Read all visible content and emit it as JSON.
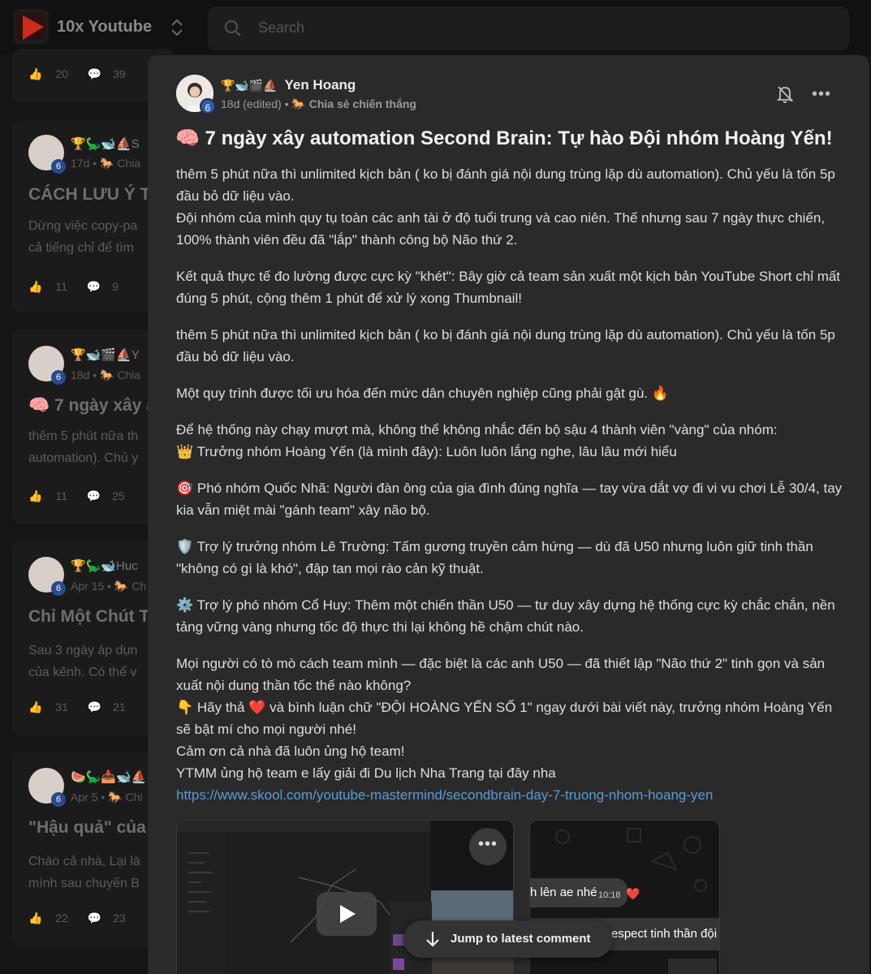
{
  "app": {
    "name": "10x Youtube",
    "search_placeholder": "Search"
  },
  "feed": {
    "top_stats": {
      "likes": "20",
      "comments": "39"
    },
    "cards": [
      {
        "badges": "🏆🦕🐋⛵",
        "author": "S",
        "meta": "17d • 🐎 Chia",
        "title": "CÁCH LƯU Ý T",
        "body1": "Dừng việc copy-pa",
        "body2": "cả tiếng chỉ để tìm",
        "likes": "11",
        "comments": "9"
      },
      {
        "badges": "🏆🐋🎬⛵",
        "author": "Y",
        "meta": "18d • 🐎 Chia",
        "title": "🧠 7 ngày xây a",
        "body1": "thêm 5 phút nữa th",
        "body2": "automation). Chủ y",
        "likes": "11",
        "comments": "25"
      },
      {
        "badges": "🏆🦕🐋",
        "author": "Huc",
        "meta": "Apr 15 • 🐎 Ch",
        "title": "Chỉ Một Chút T",
        "body1": "Sau 3 ngày áp dụn",
        "body2": "của kênh. Có thể v",
        "likes": "31",
        "comments": "21"
      },
      {
        "badges": "🍉🦕📥🐋⛵",
        "author": "",
        "meta": "Apr 5 • 🐎 Chi",
        "title": "\"Hậu quả\" của",
        "body1": "Chào cả nhà, Lại là",
        "body2": "mình sau chuyến B",
        "likes": "22",
        "comments": "23"
      }
    ]
  },
  "post": {
    "author": {
      "badges": "🏆🐋🎬⛵",
      "name": "Yen Hoang",
      "level": "6",
      "time": "18d (edited)",
      "category": "🐎 Chia sẻ chiến thắng"
    },
    "title": "🧠 7 ngày xây automation Second Brain: Tự hào Đội nhóm Hoàng Yến!",
    "paragraphs": [
      [
        "thêm 5 phút nữa thì unlimited kịch bản ( ko bị đánh giá nội dung trùng lặp dù automation). Chủ yếu là tốn 5p đầu bỏ dữ liệu vào.",
        "Đội nhóm của mình quy tụ toàn các anh tài ở độ tuổi trung và cao niên. Thế nhưng sau 7 ngày thực chiến, 100% thành viên đều đã \"lắp\" thành công bộ Não thứ 2."
      ],
      [
        "Kết quả thực tế đo lường được cực kỳ \"khét\": Bây giờ cả team sản xuất một kịch bản YouTube Short chỉ mất đúng 5 phút, cộng thêm 1 phút để xử lý xong Thumbnail!"
      ],
      [
        "thêm 5 phút nữa thì unlimited kịch bản ( ko bị đánh giá nội dung trùng lặp dù automation). Chủ yếu là tốn 5p đầu bỏ dữ liệu vào."
      ],
      [
        "Một quy trình được tối ưu hóa đến mức dân chuyên nghiệp cũng phải gật gù. 🔥"
      ],
      [
        "Để hệ thống này chạy mượt mà, không thể không nhắc đến bộ sậu 4 thành viên \"vàng\" của nhóm:",
        "👑 Trưởng nhóm Hoàng Yến (là mình đây): Luôn luôn lắng nghe, lâu lâu mới hiểu"
      ],
      [
        "🎯 Phó nhóm Quốc Nhã: Người đàn ông của gia đình đúng nghĩa — tay vừa dắt vợ đi vi vu chơi Lễ 30/4, tay kia vẫn miệt mài \"gánh team\" xây não bộ."
      ],
      [
        "🛡️ Trợ lý trưởng nhóm Lê Trường: Tấm gương truyền cảm hứng — dù đã U50 nhưng luôn giữ tinh thần \"không có gì là khó\", đập tan mọi rào cản kỹ thuật."
      ],
      [
        "⚙️ Trợ lý phó nhóm Cổ Huy: Thêm một chiến thần U50 — tư duy xây dựng hệ thống cực kỳ chắc chắn, nền tảng vững vàng nhưng tốc độ thực thi lại không hề chậm chút nào."
      ],
      [
        "Mọi người có tò mò cách team mình — đặc biệt là các anh U50 — đã thiết lập \"Não thứ 2\" tinh gọn và sản xuất nội dung thần tốc thế nào không?",
        "👇 Hãy thả ❤️ và bình luận chữ \"ĐỘI HOÀNG YẾN SỐ 1\" ngay dưới bài viết này, trưởng nhóm Hoàng Yến sẽ bật mí cho mọi người nhé!",
        "Cảm ơn cả nhà đã luôn ủng hộ team!",
        "YTMM ủng hộ team e lấy giải đi Du lịch Nha Trang tại đây nha"
      ]
    ],
    "link": "https://www.skool.com/youtube-mastermind/secondbrain-day-7-truong-nhom-hoang-yen",
    "media": {
      "chat_line1": "h lên ae nhé",
      "chat_time": "10:18",
      "chat_heart": "❤️",
      "chat_line2": "espect tinh thần đội"
    },
    "jump_label": "Jump to latest comment"
  },
  "colors": {
    "accent_link": "#5b9bd5",
    "level_badge": "#2e5bb5",
    "modal_bg": "#2a2a2a"
  }
}
